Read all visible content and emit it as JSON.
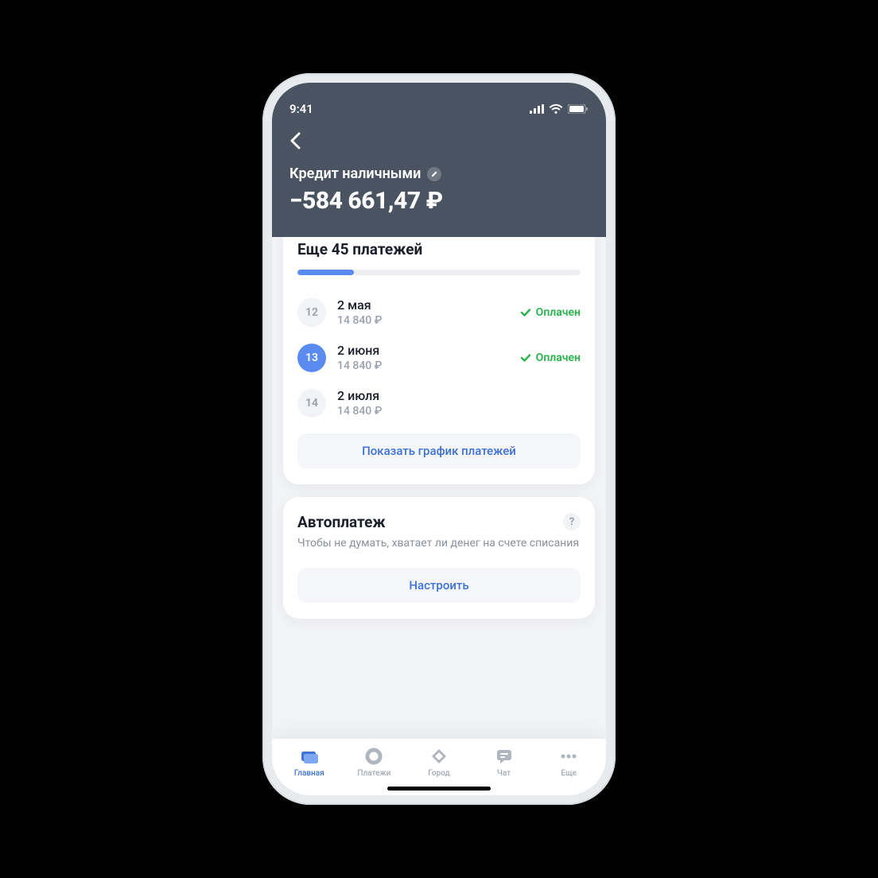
{
  "status_bar": {
    "time": "9:41"
  },
  "header": {
    "title": "Кредит наличными",
    "balance": "−584 661,47 ₽"
  },
  "payments_card": {
    "title": "Еще 45 платежей",
    "progress_percent": 20,
    "items": [
      {
        "num": "12",
        "date": "2 мая",
        "amount": "14 840 ₽",
        "status": "Оплачен",
        "active": false,
        "paid": true
      },
      {
        "num": "13",
        "date": "2 июня",
        "amount": "14 840 ₽",
        "status": "Оплачен",
        "active": true,
        "paid": true
      },
      {
        "num": "14",
        "date": "2 июля",
        "amount": "14 840 ₽",
        "status": "",
        "active": false,
        "paid": false
      }
    ],
    "button": "Показать график платежей"
  },
  "autopay_card": {
    "title": "Автоплатеж",
    "subtitle": "Чтобы не думать, хватает ли денег на счете списания",
    "button": "Настроить",
    "help": "?"
  },
  "tabbar": {
    "items": [
      {
        "label": "Главная",
        "key": "home",
        "active": true
      },
      {
        "label": "Платежи",
        "key": "payments",
        "active": false
      },
      {
        "label": "Город",
        "key": "city",
        "active": false
      },
      {
        "label": "Чат",
        "key": "chat",
        "active": false
      },
      {
        "label": "Еще",
        "key": "more",
        "active": false
      }
    ]
  }
}
